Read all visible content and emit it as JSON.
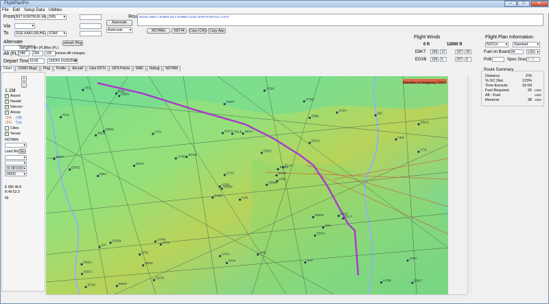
{
  "window": {
    "title": "FlightPlanPro",
    "buttons": [
      "–",
      "□",
      "✕"
    ]
  },
  "menu": [
    "File",
    "Edit",
    "Setup Data",
    "Utilities"
  ],
  "from": {
    "label": "From",
    "value": "BXT KORTRIJK-WEVELG",
    "procedure": "DPE"
  },
  "via": {
    "label": "Via"
  },
  "to": {
    "label": "To",
    "value": "DGE KARLSRUHE/BADEN",
    "procedure": "STAR"
  },
  "route": {
    "label": "Route",
    "text": "BXAN LIBET LILMEN DCT NAMBO Q781 NARAN WITLE LASAT",
    "autoroute_label": "Autoroute",
    "mode": "Autoroute",
    "buttons": [
      "NOTAMs",
      "NST44",
      "Copy ICAO",
      "Copy App"
    ]
  },
  "alternate": {
    "label": "Alternate",
    "refresh_label": "refresh Plog",
    "minimize_label": "Minimize Alt changes"
  },
  "alt": {
    "label": "Alt (FL)",
    "target_label": "Target",
    "min_label": "Min (FL)",
    "max_label": "Max (FL)",
    "target": "080",
    "min": "000",
    "max": "120"
  },
  "depart": {
    "label": "Depart Time",
    "time": "10:00",
    "date": "23/DPx 01/02/2008"
  },
  "tabs": [
    "Chart",
    "CFMU Msgs",
    "Plog",
    "Profile",
    "Aircraft",
    "User DCTs",
    "GPS Points",
    "RAD",
    "Debug",
    "NOTAM"
  ],
  "left_panel": {
    "scale": "1.1M",
    "layers": [
      {
        "label": "Airport",
        "checked": true
      },
      {
        "label": "Navaid",
        "checked": true
      },
      {
        "label": "Intersxn",
        "checked": true
      },
      {
        "label": "Airway",
        "checked": true
      }
    ],
    "airway_opts": [
      "(34)",
      "(18)",
      "(24)",
      "Cny"
    ],
    "cities": {
      "label": "Cities",
      "checked": false
    },
    "terrain": {
      "label": "Terrain",
      "checked": true
    },
    "notams_label": "NOTAMs",
    "load_wx_label": "Load Wx?",
    "load_wx_btn": "Go",
    "dropdowns": [
      "",
      "",
      "20.08/1000",
      "24000"
    ],
    "coord_e": "E 006 46.8",
    "coord_n": "N 49 52.0",
    "extra": "56"
  },
  "flight_winds": {
    "title": "Flight Winds",
    "col1": "0 ft",
    "col2": "12000 ft",
    "rows": [
      {
        "id": "EBKT",
        "a1": "186",
        "a2": "12",
        "b1": "197",
        "b2": "30"
      },
      {
        "id": "EDSB",
        "a1": "106",
        "a2": "5",
        "b1": "207",
        "b2": "9"
      }
    ]
  },
  "fpi": {
    "title": "Flight Plan Information",
    "aircraft": "N2012c",
    "profile": "Standard",
    "fuel_label": "Fuel on Board",
    "fuel": "64",
    "fuel_unit": "USG",
    "pob_label": "PoB",
    "spec_grav_label": "Spec Grav",
    "spec_grav": "0.72"
  },
  "route_summary": {
    "title": "Route Summary",
    "rows": [
      {
        "k": "Distance",
        "v": "276",
        "u": ""
      },
      {
        "k": "% GC Dist.",
        "v": "123%",
        "u": ""
      },
      {
        "k": "Time Enroute",
        "v": "02:09",
        "u": ""
      },
      {
        "k": "Fuel Required",
        "v": "26",
        "u": "USG"
      },
      {
        "k": "Alt - Fuel",
        "v": "",
        "u": "USG"
      },
      {
        "k": "Reserve",
        "v": "38",
        "u": "USG"
      }
    ]
  },
  "map": {
    "label_top": "Elevation is Imaginary ONLY",
    "waypoints": [
      "KOK",
      "EBLE",
      "EBZW",
      "EBSU",
      "EBOS",
      "LFAC",
      "LFQQ",
      "EBCV",
      "EBBL",
      "EBMB",
      "EBBX",
      "EBKT",
      "EBCI",
      "EBLG",
      "EHBK",
      "EDLN",
      "EDDK",
      "EDKV",
      "EDFE",
      "EDFM",
      "EDSB",
      "EBFS",
      "EBSP",
      "EBLB",
      "ELLX",
      "ELLA",
      "EDRS",
      "EDRT",
      "EDRZ",
      "EDDR",
      "LFJL",
      "LFSO",
      "LFGA",
      "LFSX",
      "LFSI",
      "LFQV",
      "LFPM",
      "LFOB",
      "LFPC",
      "LFAT",
      "LFSN",
      "LFSD",
      "EDFZ",
      "EDFV",
      "EDTG",
      "EDSA",
      "ETAR",
      "ETAD",
      "NTM",
      "HTM",
      "SPI",
      "CDZ",
      "PGS",
      "DVL",
      "SAV",
      "GTQ",
      "BSN",
      "CRL",
      "ARD",
      "DIK"
    ],
    "colors": {
      "land": "#7fe08a",
      "water": "#8fb6e8",
      "route": "#a73cc8",
      "airway": "#2e3a3f",
      "restricted": "#d84a3a"
    }
  }
}
